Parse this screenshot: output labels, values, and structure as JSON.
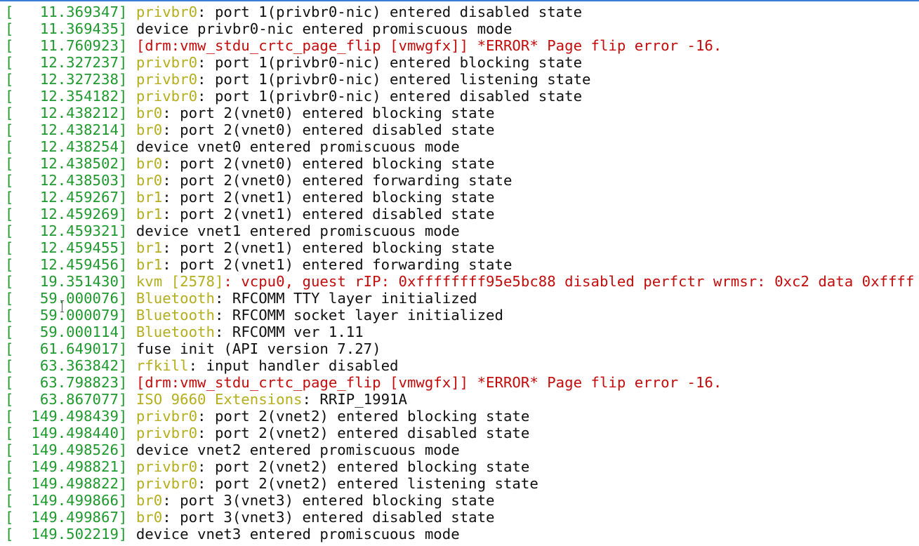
{
  "colors": {
    "timestamp": "#1f9a2e",
    "prefix": "#b5ae1e",
    "error": "#c40c0c",
    "text": "#111111",
    "accent": "#3a7bd5"
  },
  "lines": [
    {
      "ts": "[   11.369347]",
      "prefix": "privbr0",
      "msg": ": port 1(privbr0-nic) entered disabled state",
      "error": false
    },
    {
      "ts": "[   11.369435]",
      "prefix": "",
      "msg": "device privbr0-nic entered promiscuous mode",
      "error": false
    },
    {
      "ts": "[   11.760923]",
      "prefix": "",
      "msg": "[drm:vmw_stdu_crtc_page_flip [vmwgfx]] *ERROR* Page flip error -16.",
      "error": true
    },
    {
      "ts": "[   12.327237]",
      "prefix": "privbr0",
      "msg": ": port 1(privbr0-nic) entered blocking state",
      "error": false
    },
    {
      "ts": "[   12.327238]",
      "prefix": "privbr0",
      "msg": ": port 1(privbr0-nic) entered listening state",
      "error": false
    },
    {
      "ts": "[   12.354182]",
      "prefix": "privbr0",
      "msg": ": port 1(privbr0-nic) entered disabled state",
      "error": false
    },
    {
      "ts": "[   12.438212]",
      "prefix": "br0",
      "msg": ": port 2(vnet0) entered blocking state",
      "error": false
    },
    {
      "ts": "[   12.438214]",
      "prefix": "br0",
      "msg": ": port 2(vnet0) entered disabled state",
      "error": false
    },
    {
      "ts": "[   12.438254]",
      "prefix": "",
      "msg": "device vnet0 entered promiscuous mode",
      "error": false
    },
    {
      "ts": "[   12.438502]",
      "prefix": "br0",
      "msg": ": port 2(vnet0) entered blocking state",
      "error": false
    },
    {
      "ts": "[   12.438503]",
      "prefix": "br0",
      "msg": ": port 2(vnet0) entered forwarding state",
      "error": false
    },
    {
      "ts": "[   12.459267]",
      "prefix": "br1",
      "msg": ": port 2(vnet1) entered blocking state",
      "error": false
    },
    {
      "ts": "[   12.459269]",
      "prefix": "br1",
      "msg": ": port 2(vnet1) entered disabled state",
      "error": false
    },
    {
      "ts": "[   12.459321]",
      "prefix": "",
      "msg": "device vnet1 entered promiscuous mode",
      "error": false
    },
    {
      "ts": "[   12.459455]",
      "prefix": "br1",
      "msg": ": port 2(vnet1) entered blocking state",
      "error": false
    },
    {
      "ts": "[   12.459456]",
      "prefix": "br1",
      "msg": ": port 2(vnet1) entered forwarding state",
      "error": false
    },
    {
      "ts": "[   19.351430]",
      "prefix": "kvm [2578]",
      "msg": ": vcpu0, guest rIP: 0xffffffff95e5bc88 disabled perfctr wrmsr: 0xc2 data 0xffff",
      "error": true
    },
    {
      "ts": "[   59.000076]",
      "prefix": "Bluetooth",
      "msg": ": RFCOMM TTY layer initialized",
      "error": false
    },
    {
      "ts": "[   59.000079]",
      "prefix": "Bluetooth",
      "msg": ": RFCOMM socket layer initialized",
      "error": false
    },
    {
      "ts": "[   59.000114]",
      "prefix": "Bluetooth",
      "msg": ": RFCOMM ver 1.11",
      "error": false
    },
    {
      "ts": "[   61.649017]",
      "prefix": "",
      "msg": "fuse init (API version 7.27)",
      "error": false
    },
    {
      "ts": "[   63.363842]",
      "prefix": "rfkill",
      "msg": ": input handler disabled",
      "error": false
    },
    {
      "ts": "[   63.798823]",
      "prefix": "",
      "msg": "[drm:vmw_stdu_crtc_page_flip [vmwgfx]] *ERROR* Page flip error -16.",
      "error": true
    },
    {
      "ts": "[   63.867077]",
      "prefix": "ISO 9660 Extensions",
      "msg": ": RRIP_1991A",
      "error": false
    },
    {
      "ts": "[  149.498439]",
      "prefix": "privbr0",
      "msg": ": port 2(vnet2) entered blocking state",
      "error": false
    },
    {
      "ts": "[  149.498440]",
      "prefix": "privbr0",
      "msg": ": port 2(vnet2) entered disabled state",
      "error": false
    },
    {
      "ts": "[  149.498526]",
      "prefix": "",
      "msg": "device vnet2 entered promiscuous mode",
      "error": false
    },
    {
      "ts": "[  149.498821]",
      "prefix": "privbr0",
      "msg": ": port 2(vnet2) entered blocking state",
      "error": false
    },
    {
      "ts": "[  149.498822]",
      "prefix": "privbr0",
      "msg": ": port 2(vnet2) entered listening state",
      "error": false
    },
    {
      "ts": "[  149.499866]",
      "prefix": "br0",
      "msg": ": port 3(vnet3) entered blocking state",
      "error": false
    },
    {
      "ts": "[  149.499867]",
      "prefix": "br0",
      "msg": ": port 3(vnet3) entered disabled state",
      "error": false
    },
    {
      "ts": "[  149.502219]",
      "prefix": "",
      "msg": "device vnet3 entered promiscuous mode",
      "error": false
    }
  ]
}
